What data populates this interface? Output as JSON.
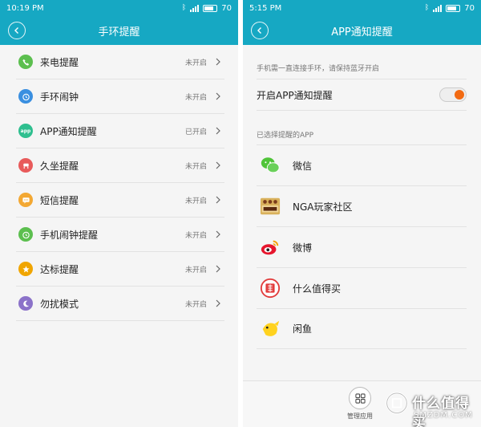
{
  "left": {
    "status_time": "10:19 PM",
    "battery": "70",
    "title": "手环提醒",
    "items": [
      {
        "label": "来电提醒",
        "status": "未开启",
        "icon": "phone-icon",
        "color": "#5cbf4f"
      },
      {
        "label": "手环闹钟",
        "status": "未开启",
        "icon": "alarm-icon",
        "color": "#3a8fe0"
      },
      {
        "label": "APP通知提醒",
        "status": "已开启",
        "icon": "app-icon",
        "color": "#2fbf8f",
        "badge": "app"
      },
      {
        "label": "久坐提醒",
        "status": "未开启",
        "icon": "chair-icon",
        "color": "#e85a5a"
      },
      {
        "label": "短信提醒",
        "status": "未开启",
        "icon": "message-icon",
        "color": "#f3a833"
      },
      {
        "label": "手机闹钟提醒",
        "status": "未开启",
        "icon": "phone-alarm-icon",
        "color": "#5cbf4f"
      },
      {
        "label": "达标提醒",
        "status": "未开启",
        "icon": "star-icon",
        "color": "#f0a500"
      },
      {
        "label": "勿扰模式",
        "status": "未开启",
        "icon": "moon-icon",
        "color": "#8b72c9"
      }
    ]
  },
  "right": {
    "status_time": "5:15 PM",
    "battery": "70",
    "title": "APP通知提醒",
    "hint": "手机需一直连接手环，请保持蓝牙开启",
    "toggle_label": "开启APP通知提醒",
    "toggle_on": true,
    "section_label": "已选择提醒的APP",
    "apps": [
      {
        "name": "微信",
        "icon": "wechat-icon"
      },
      {
        "name": "NGA玩家社区",
        "icon": "nga-icon"
      },
      {
        "name": "微博",
        "icon": "weibo-icon"
      },
      {
        "name": "什么值得买",
        "icon": "smzdm-icon"
      },
      {
        "name": "闲鱼",
        "icon": "xianyu-icon"
      }
    ],
    "manage_label": "管理应用"
  },
  "watermark": {
    "text": "什么值得买",
    "sub": "SMZDM.COM"
  },
  "colors": {
    "header": "#16a8c3",
    "toggle_accent": "#f26a12"
  }
}
